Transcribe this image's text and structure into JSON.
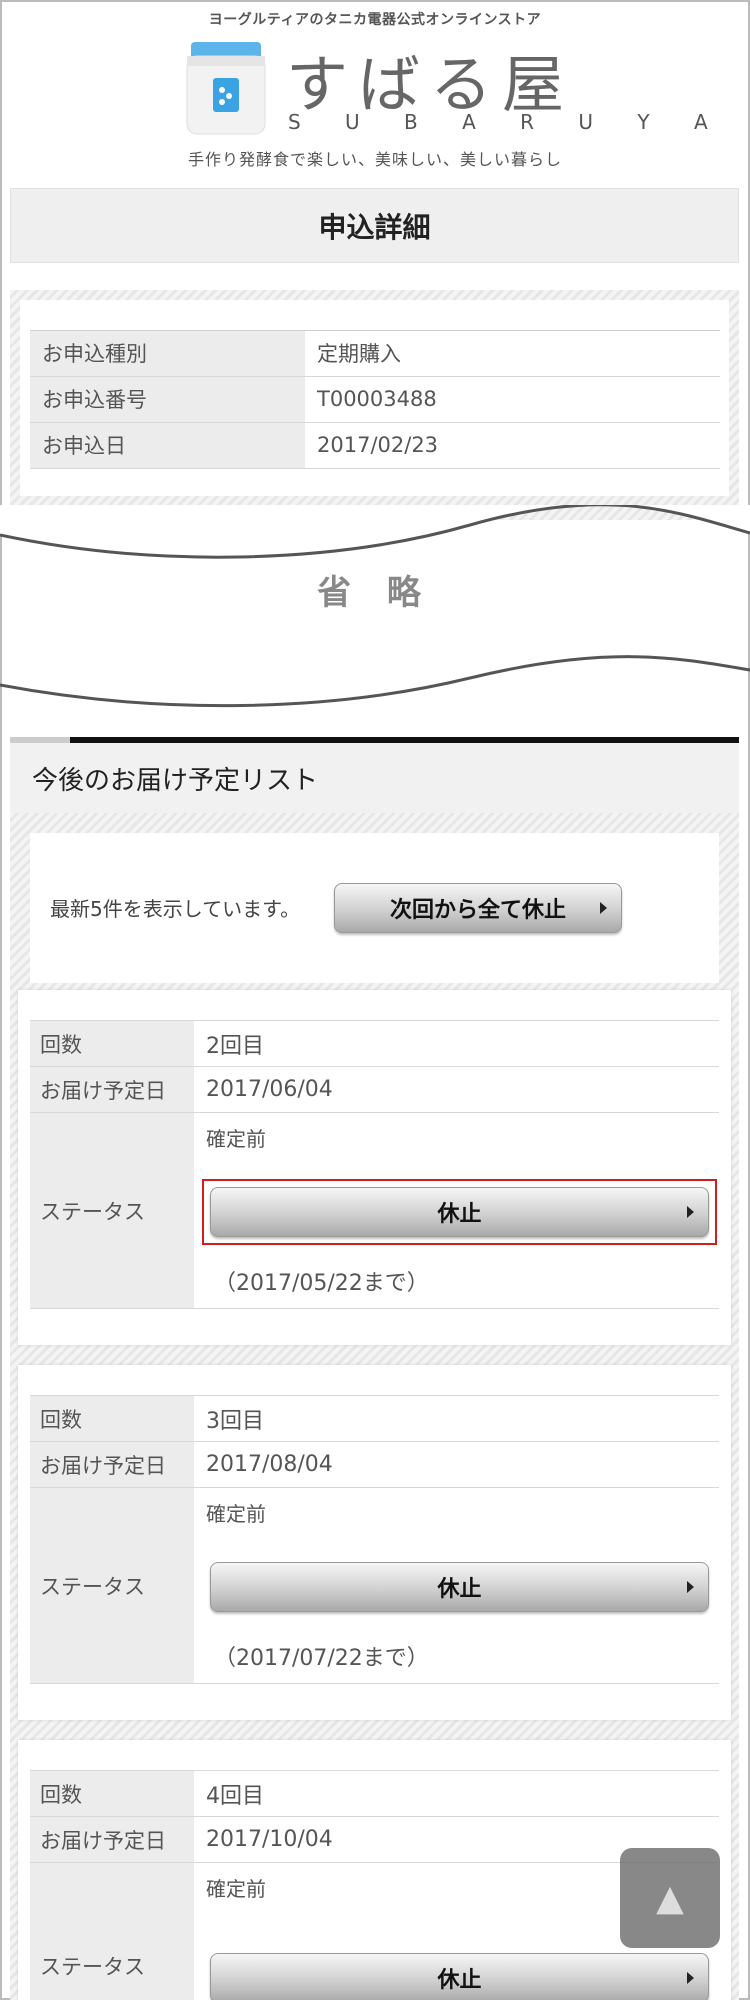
{
  "header": {
    "tagline_top": "ヨーグルティアのタニカ電器公式オンラインストア",
    "store_name": "すばる屋",
    "store_name_latin": "S U B A R U Y A",
    "tagline_bottom": "手作り発酵食で楽しい、美味しい、美しい暮らし"
  },
  "page_title": "申込詳細",
  "order_info": [
    {
      "label": "お申込種別",
      "value": "定期購入"
    },
    {
      "label": "お申込番号",
      "value": "T00003488"
    },
    {
      "label": "お申込日",
      "value": "2017/02/23"
    }
  ],
  "omitted_label": "省 略",
  "delivery_list": {
    "title": "今後のお届け予定リスト",
    "info_text": "最新5件を表示しています。",
    "suspend_all_label": "次回から全て休止",
    "labels": {
      "count": "回数",
      "date": "お届け予定日",
      "status": "ステータス"
    },
    "items": [
      {
        "count": "2回目",
        "date": "2017/06/04",
        "status": "確定前",
        "button": "休止",
        "until": "（2017/05/22まで）"
      },
      {
        "count": "3回目",
        "date": "2017/08/04",
        "status": "確定前",
        "button": "休止",
        "until": "（2017/07/22まで）"
      },
      {
        "count": "4回目",
        "date": "2017/10/04",
        "status": "確定前",
        "button": "休止",
        "until": ""
      }
    ]
  },
  "scroll_top_glyph": "▲",
  "colors": {
    "highlight": "#d21e1e",
    "jar_blue": "#3aa3e3"
  }
}
